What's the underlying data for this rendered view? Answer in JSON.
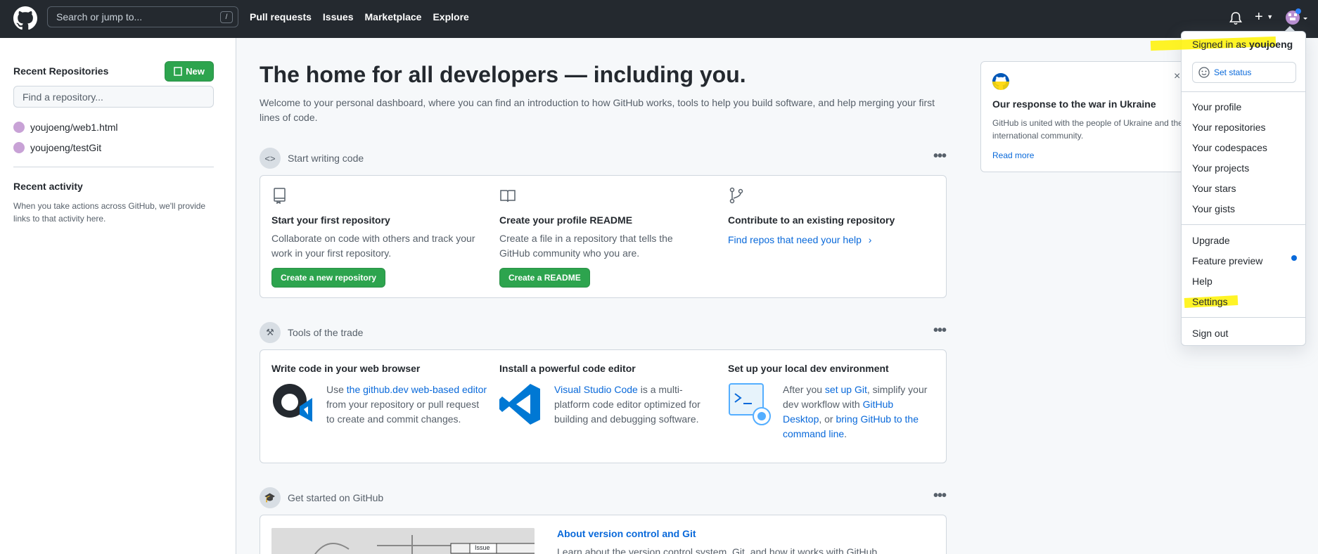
{
  "header": {
    "search_placeholder": "Search or jump to...",
    "search_shortcut": "/",
    "nav": [
      "Pull requests",
      "Issues",
      "Marketplace",
      "Explore"
    ],
    "plus_label": "+"
  },
  "sidebar": {
    "recent_repos_title": "Recent Repositories",
    "new_button": "New",
    "find_placeholder": "Find a repository...",
    "repos": [
      "youjoeng/web1.html",
      "youjoeng/testGit"
    ],
    "recent_activity_title": "Recent activity",
    "recent_activity_text": "When you take actions across GitHub, we'll provide links to that activity here."
  },
  "main": {
    "title": "The home for all developers — including you.",
    "subtitle": "Welcome to your personal dashboard, where you can find an introduction to how GitHub works, tools to help you build software, and help merging your first lines of code.",
    "section1": {
      "title": "Start writing code",
      "cols": [
        {
          "title": "Start your first repository",
          "text": "Collaborate on code with others and track your work in your first repository.",
          "button": "Create a new repository"
        },
        {
          "title": "Create your profile README",
          "text": "Create a file in a repository that tells the GitHub community who you are.",
          "button": "Create a README"
        },
        {
          "title": "Contribute to an existing repository",
          "link": "Find repos that need your help"
        }
      ]
    },
    "section2": {
      "title": "Tools of the trade",
      "cols": [
        {
          "title": "Write code in your web browser",
          "t1": "Use ",
          "l1": "the github.dev web-based editor",
          "t2": " from your repository or pull request to create and commit changes."
        },
        {
          "title": "Install a powerful code editor",
          "l1": "Visual Studio Code",
          "t2": " is a multi-platform code editor optimized for building and debugging software."
        },
        {
          "title": "Set up your local dev environment",
          "t1": "After you ",
          "l1": "set up Git",
          "t2": ", simplify your dev workflow with ",
          "l2": "GitHub Desktop",
          "t3": ", or ",
          "l3": "bring GitHub to the command line",
          "t4": "."
        }
      ]
    },
    "section3": {
      "title": "Get started on GitHub",
      "article_title": "About version control and Git",
      "article_text": "Learn about the version control system, Git, and how it works with GitHub.",
      "thumb_label": "Issue"
    }
  },
  "ukraine": {
    "title": "Our response to the war in Ukraine",
    "text": "GitHub is united with the people of Ukraine and the international community.",
    "read_more": "Read more",
    "close": "×"
  },
  "dropdown": {
    "signed_in_prefix": "Signed in as ",
    "username": "youjoeng",
    "set_status": "Set status",
    "group1": [
      "Your profile",
      "Your repositories",
      "Your codespaces",
      "Your projects",
      "Your stars",
      "Your gists"
    ],
    "group2": [
      "Upgrade",
      "Feature preview",
      "Help",
      "Settings"
    ],
    "sign_out": "Sign out"
  },
  "colors": {
    "header_bg": "#24292f",
    "green": "#2da44e",
    "link": "#0969da",
    "highlight": "#fff200"
  }
}
